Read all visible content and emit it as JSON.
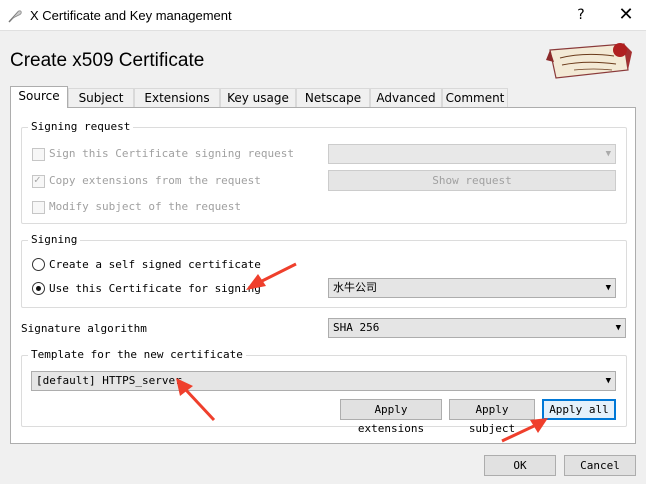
{
  "window": {
    "title": "X Certificate and Key management",
    "help_label": "?",
    "close_label": "✕"
  },
  "dialog": {
    "heading": "Create x509 Certificate"
  },
  "tabs": [
    {
      "label": "Source",
      "active": true
    },
    {
      "label": "Subject"
    },
    {
      "label": "Extensions"
    },
    {
      "label": "Key usage"
    },
    {
      "label": "Netscape"
    },
    {
      "label": "Advanced"
    },
    {
      "label": "Comment"
    }
  ],
  "signing_request": {
    "title": "Signing request",
    "sign_csr_label": "Sign this Certificate signing request",
    "sign_csr_checked": false,
    "copy_ext_label": "Copy extensions from the request",
    "copy_ext_checked": true,
    "modify_subject_label": "Modify subject of the request",
    "modify_subject_checked": false,
    "csr_select_value": "",
    "show_request_label": "Show request"
  },
  "signing": {
    "title": "Signing",
    "self_signed_label": "Create a self signed certificate",
    "self_signed_selected": false,
    "use_cert_label": "Use this Certificate for signing",
    "use_cert_selected": true,
    "signing_cert_value": "水牛公司"
  },
  "signature_algorithm": {
    "label": "Signature algorithm",
    "value": "SHA 256"
  },
  "template": {
    "title": "Template for the new certificate",
    "value": "[default] HTTPS_server",
    "apply_extensions_label": "Apply extensions",
    "apply_subject_label": "Apply subject",
    "apply_all_label": "Apply all"
  },
  "footer": {
    "ok_label": "OK",
    "cancel_label": "Cancel"
  },
  "colors": {
    "annotation_arrow": "#ef3f2c",
    "focus_blue": "#0078d7"
  }
}
